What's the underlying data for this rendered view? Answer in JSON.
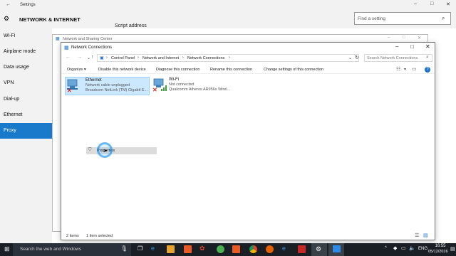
{
  "settings": {
    "window_title": "Settings",
    "section_title": "NETWORK & INTERNET",
    "search_placeholder": "Find a setting",
    "nav_items": [
      {
        "label": "Wi-Fi"
      },
      {
        "label": "Airplane mode"
      },
      {
        "label": "Data usage"
      },
      {
        "label": "VPN"
      },
      {
        "label": "Dial-up"
      },
      {
        "label": "Ethernet"
      },
      {
        "label": "Proxy"
      }
    ],
    "partial_text": "Script address"
  },
  "nsc": {
    "title": "Network and Sharing Center"
  },
  "nc": {
    "title": "Network Connections",
    "breadcrumb": [
      "Control Panel",
      "Network and Internet",
      "Network Connections"
    ],
    "search_placeholder": "Search Network Connections",
    "toolbar": {
      "organize": "Organize",
      "disable": "Disable this network device",
      "diagnose": "Diagnose this connection",
      "rename": "Rename this connection",
      "change": "Change settings of this connection"
    },
    "adapters": [
      {
        "name": "Ethernet",
        "status": "Network cable unplugged",
        "device": "Broadcom NetLink (TM) Gigabit E..."
      },
      {
        "name": "Wi-Fi",
        "status": "Not connected",
        "device": "Qualcomm Atheros AR956x Wirel..."
      }
    ],
    "context_item": "Properties",
    "status_items": "2 items",
    "status_selected": "1 item selected"
  },
  "taskbar": {
    "search_placeholder": "Search the web and Windows",
    "language": "ENG",
    "time": "16:55",
    "date": "05/12/2016"
  },
  "colors": {
    "accent": "#1979ca",
    "selected_bg": "#cce8ff",
    "taskbar": "#1a1f26"
  }
}
